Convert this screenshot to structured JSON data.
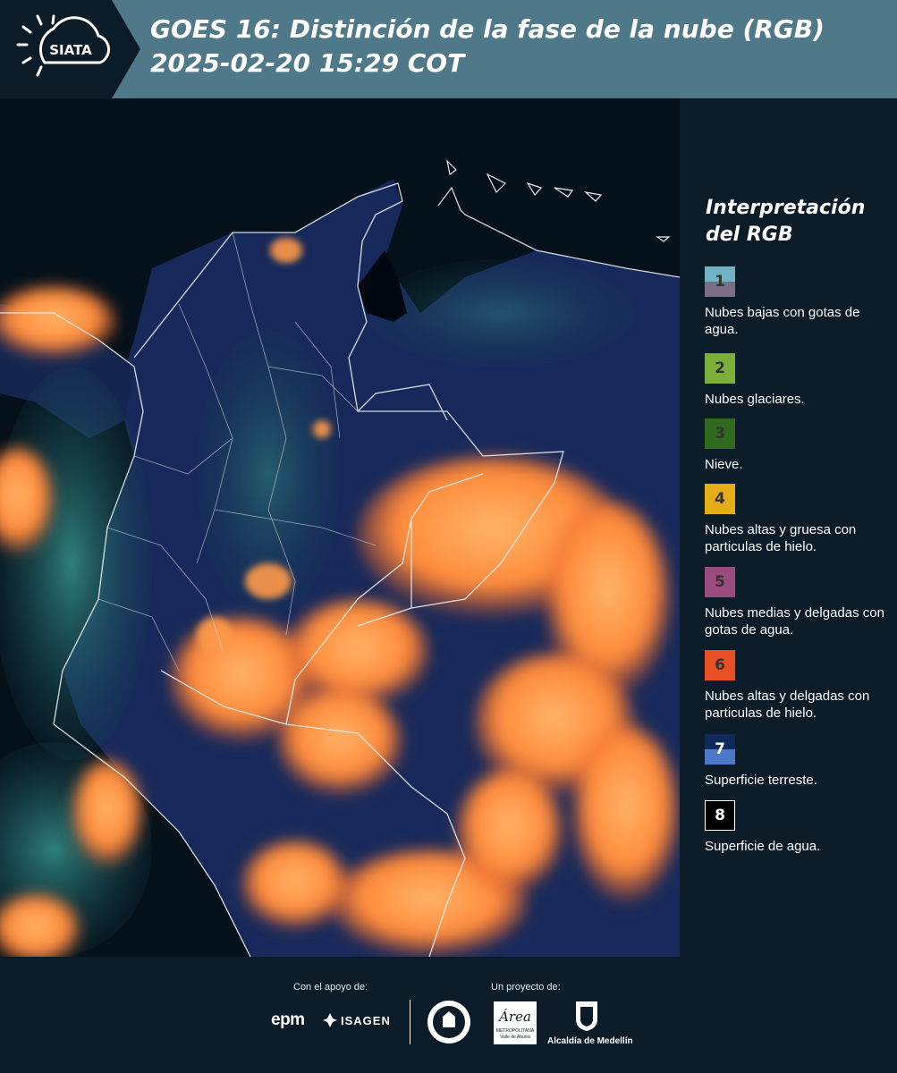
{
  "header": {
    "logo_text": "SIATA",
    "title": "GOES 16: Distinción de la fase de la nube (RGB)\n 2025-02-20 15:29 COT"
  },
  "legend": {
    "title": "Interpretación del RGB",
    "items": [
      {
        "number": "1",
        "label": "Nubes bajas con gotas de agua.",
        "color_top": "#6fb3c5",
        "color_bottom": "#7b6e86"
      },
      {
        "number": "2",
        "label": "Nubes glaciares.",
        "color": "#7ab03a"
      },
      {
        "number": "3",
        "label": "Nieve.",
        "color": "#2f6a1e"
      },
      {
        "number": "4",
        "label": "Nubes altas y gruesa con particulas de hielo.",
        "color": "#e5ad18"
      },
      {
        "number": "5",
        "label": "Nubes medias y delgadas con gotas de agua.",
        "color": "#9a4b7e"
      },
      {
        "number": "6",
        "label": "Nubes altas y delgadas con particulas de hielo.",
        "color": "#e84f24"
      },
      {
        "number": "7",
        "label": "Superficie terreste.",
        "color_top": "#0f2a5a",
        "color_bottom": "#4b78c8"
      },
      {
        "number": "8",
        "label": "Superficie de agua.",
        "color": "#000000"
      }
    ]
  },
  "footer": {
    "support_caption": "Con el apoyo de:",
    "project_caption": "Un proyecto de:",
    "sponsor_epm": "epm",
    "sponsor_isagen": "ISAGEN",
    "area_logo_text": "Área",
    "area_sub1": "METROPOLITANA",
    "area_sub2": "Valle de Aburrá",
    "alcaldia_text": "Alcaldía de Medellín"
  },
  "colors": {
    "header_bg": "#4f7888",
    "panel_bg": "#0b1c28",
    "cloud_orange": "#ff9a4a",
    "land_blue": "#1b2f5c"
  }
}
